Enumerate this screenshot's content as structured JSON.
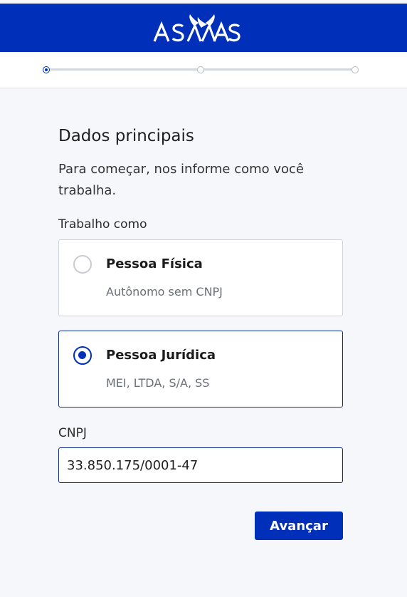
{
  "header": {
    "logo_text": "ASAAS",
    "brand_color": "#0030b9"
  },
  "stepper": {
    "total_steps": 3,
    "current_step": 1
  },
  "form": {
    "title": "Dados principais",
    "subtitle": "Para começar, nos informe como você trabalha.",
    "work_as_label": "Trabalho como",
    "options": [
      {
        "title": "Pessoa Física",
        "description": "Autônomo sem CNPJ",
        "selected": false
      },
      {
        "title": "Pessoa Jurídica",
        "description": "MEI, LTDA, S/A, SS",
        "selected": true
      }
    ],
    "cnpj_label": "CNPJ",
    "cnpj_value": "33.850.175/0001-47",
    "submit_label": "Avançar"
  }
}
